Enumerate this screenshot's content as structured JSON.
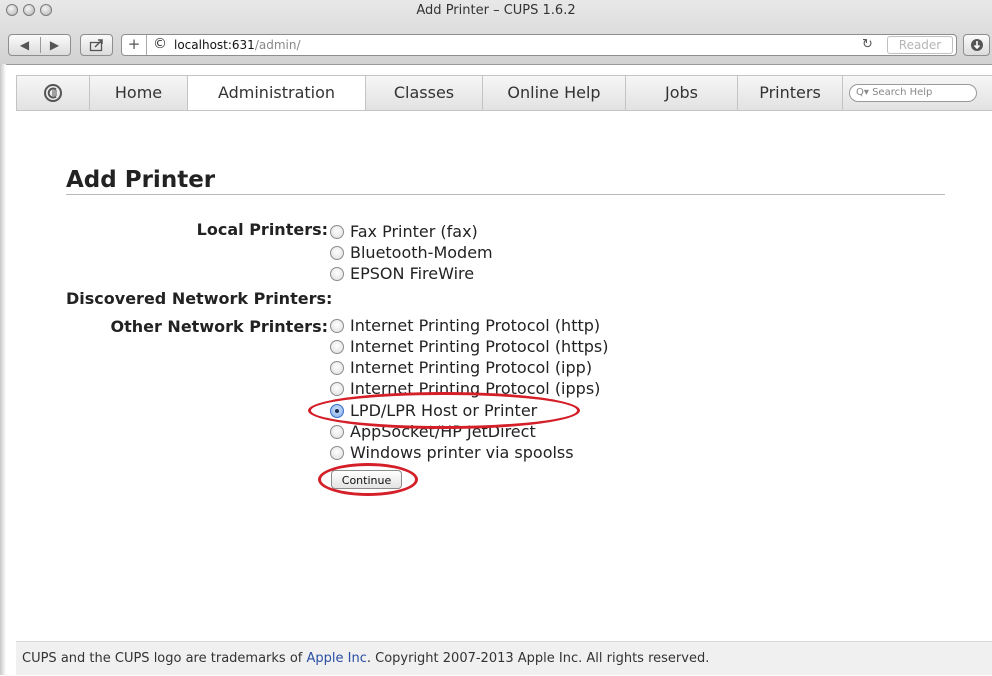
{
  "window": {
    "title": "Add Printer – CUPS 1.6.2"
  },
  "toolbar": {
    "back_icon": "◀",
    "forward_icon": "▶",
    "share_icon": "share-icon",
    "add_icon": "+",
    "url_host": "localhost:631",
    "url_path": "/admin/",
    "reader_label": "Reader"
  },
  "nav": {
    "tabs": [
      "Home",
      "Administration",
      "Classes",
      "Online Help",
      "Jobs",
      "Printers"
    ],
    "active_tab": "Administration",
    "search_placeholder": "Q▾ Search Help"
  },
  "page": {
    "heading": "Add Printer",
    "local_label": "Local Printers:",
    "local_options": [
      "Fax Printer (fax)",
      "Bluetooth-Modem",
      "EPSON FireWire"
    ],
    "discovered_label": "Discovered Network Printers:",
    "other_label": "Other Network Printers:",
    "other_options": [
      "Internet Printing Protocol (http)",
      "Internet Printing Protocol (https)",
      "Internet Printing Protocol (ipp)",
      "Internet Printing Protocol (ipps)",
      "LPD/LPR Host or Printer",
      "AppSocket/HP JetDirect",
      "Windows printer via spoolss"
    ],
    "selected_option": "LPD/LPR Host or Printer",
    "continue_label": "Continue"
  },
  "footer": {
    "text_before": "CUPS and the CUPS logo are trademarks of ",
    "link": "Apple Inc",
    "text_after": ". Copyright 2007-2013 Apple Inc. All rights reserved."
  },
  "colors": {
    "annotation_ring": "#d41e28",
    "link": "#2b4fa3"
  }
}
